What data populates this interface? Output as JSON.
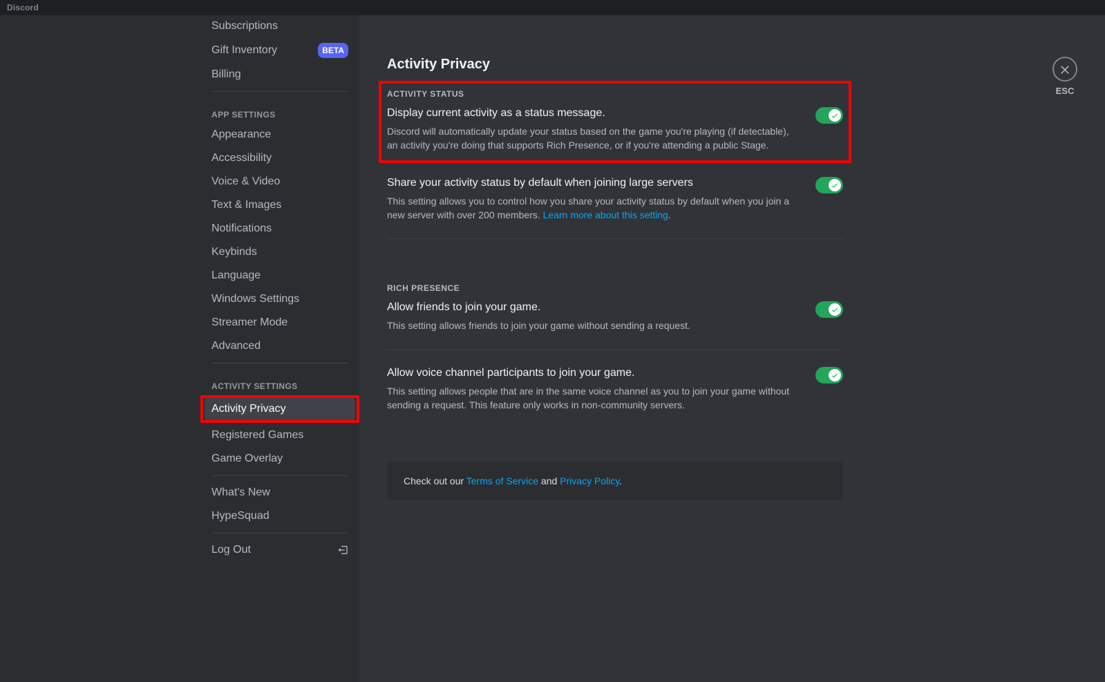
{
  "titlebar": {
    "app_name": "Discord"
  },
  "sidebar": {
    "subscriptions": "Subscriptions",
    "gift_inventory": "Gift Inventory",
    "beta_badge": "BETA",
    "billing": "Billing",
    "app_settings_header": "APP SETTINGS",
    "appearance": "Appearance",
    "accessibility": "Accessibility",
    "voice_video": "Voice & Video",
    "text_images": "Text & Images",
    "notifications": "Notifications",
    "keybinds": "Keybinds",
    "language": "Language",
    "windows_settings": "Windows Settings",
    "streamer_mode": "Streamer Mode",
    "advanced": "Advanced",
    "activity_settings_header": "ACTIVITY SETTINGS",
    "activity_privacy": "Activity Privacy",
    "registered_games": "Registered Games",
    "game_overlay": "Game Overlay",
    "whats_new": "What's New",
    "hypesquad": "HypeSquad",
    "log_out": "Log Out"
  },
  "content": {
    "page_title": "Activity Privacy",
    "activity_status_header": "ACTIVITY STATUS",
    "display_activity": {
      "title": "Display current activity as a status message.",
      "desc": "Discord will automatically update your status based on the game you're playing (if detectable), an activity you're doing that supports Rich Presence, or if you're attending a public Stage."
    },
    "share_large": {
      "title": "Share your activity status by default when joining large servers",
      "desc_pre": "This setting allows you to control how you share your activity status by default when you join a new server with over 200 members. ",
      "link": "Learn more about this setting",
      "desc_post": "."
    },
    "rich_presence_header": "RICH PRESENCE",
    "friends_join": {
      "title": "Allow friends to join your game.",
      "desc": "This setting allows friends to join your game without sending a request."
    },
    "voice_join": {
      "title": "Allow voice channel participants to join your game.",
      "desc": "This setting allows people that are in the same voice channel as you to join your game without sending a request. This feature only works in non-community servers."
    },
    "tos": {
      "pre": "Check out our ",
      "tos_link": "Terms of Service",
      "mid": " and ",
      "pp_link": "Privacy Policy",
      "post": "."
    }
  },
  "close": {
    "esc": "ESC"
  }
}
